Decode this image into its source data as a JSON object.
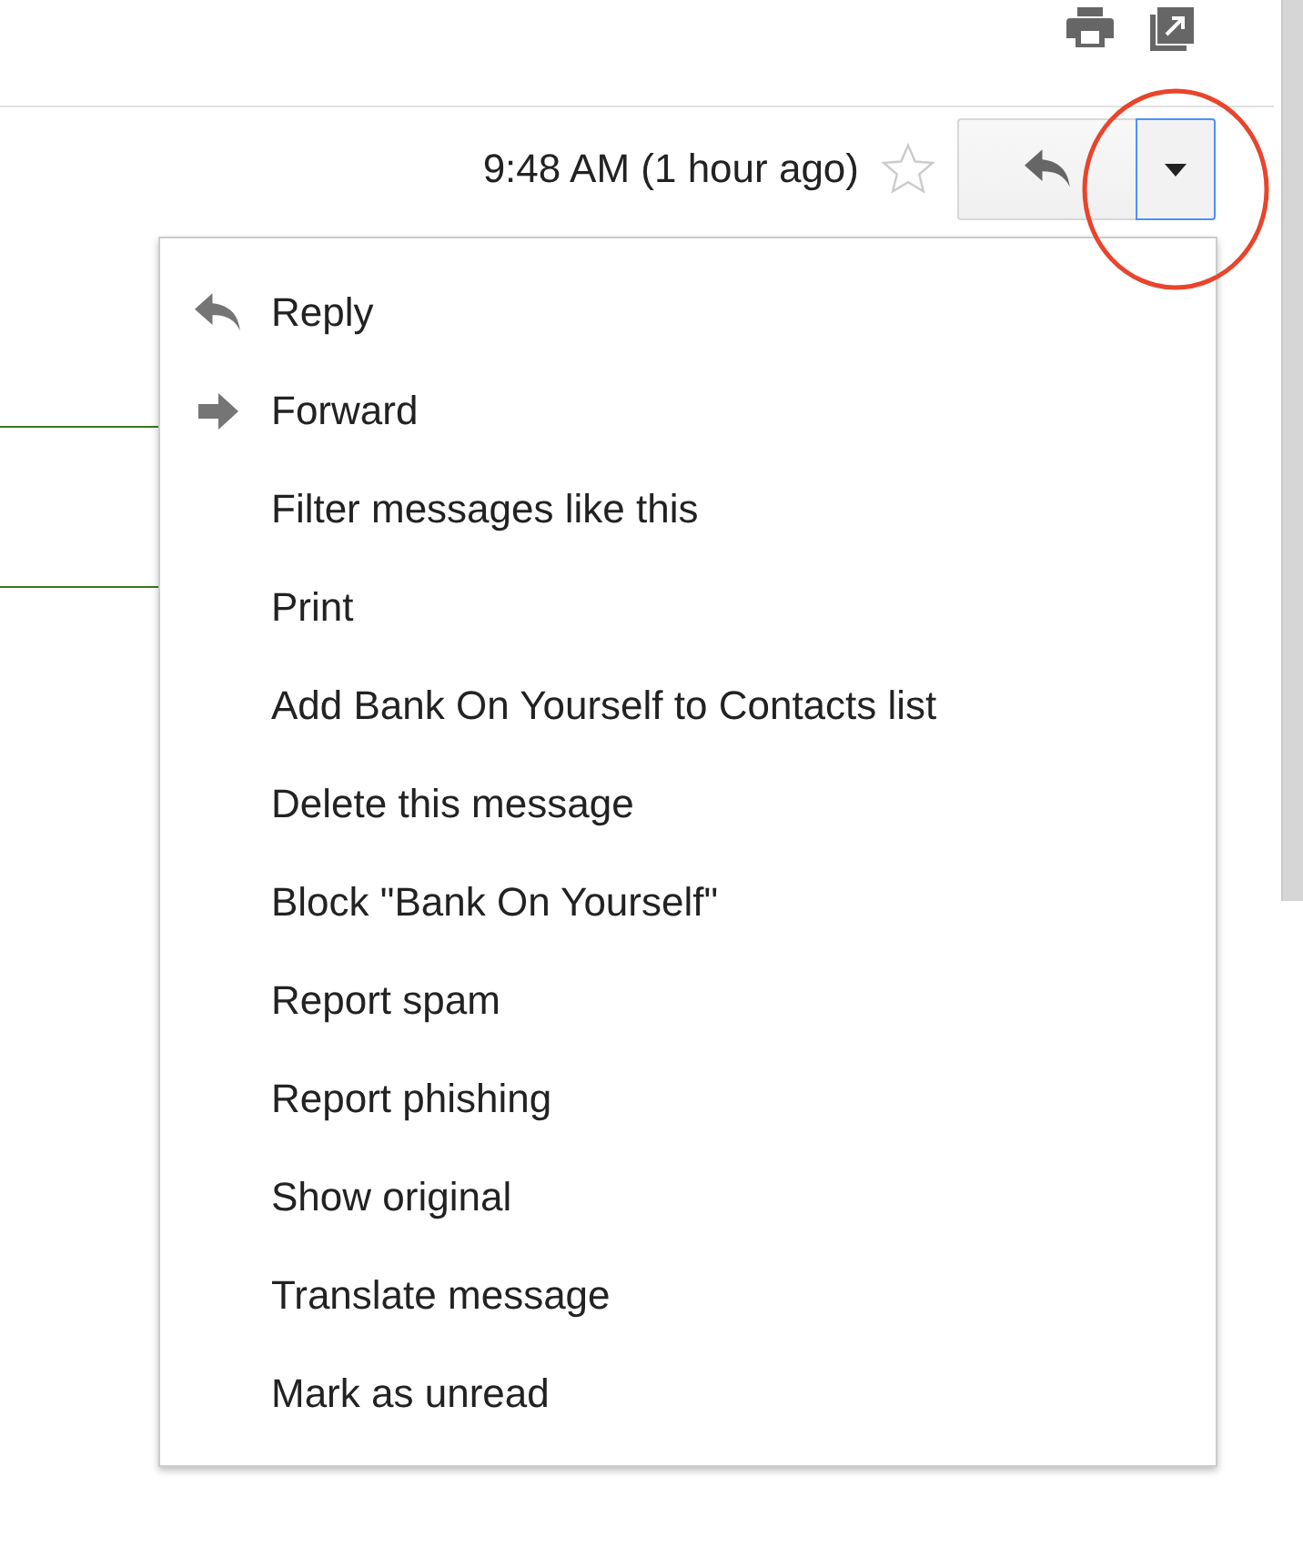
{
  "message_header": {
    "time": "9:48 AM (1 hour ago)",
    "starred": false
  },
  "menu": {
    "items": [
      {
        "label": "Reply",
        "kind": "reply"
      },
      {
        "label": "Forward",
        "kind": "forward"
      },
      {
        "label": "Filter messages like this",
        "kind": "plain"
      },
      {
        "label": "Print",
        "kind": "plain"
      },
      {
        "label": "Add Bank On Yourself to Contacts list",
        "kind": "plain"
      },
      {
        "label": "Delete this message",
        "kind": "plain"
      },
      {
        "label": "Block \"Bank On Yourself\"",
        "kind": "plain"
      },
      {
        "label": "Report spam",
        "kind": "plain"
      },
      {
        "label": "Report phishing",
        "kind": "plain"
      },
      {
        "label": "Show original",
        "kind": "plain"
      },
      {
        "label": "Translate message",
        "kind": "plain"
      },
      {
        "label": "Mark as unread",
        "kind": "plain"
      }
    ]
  }
}
